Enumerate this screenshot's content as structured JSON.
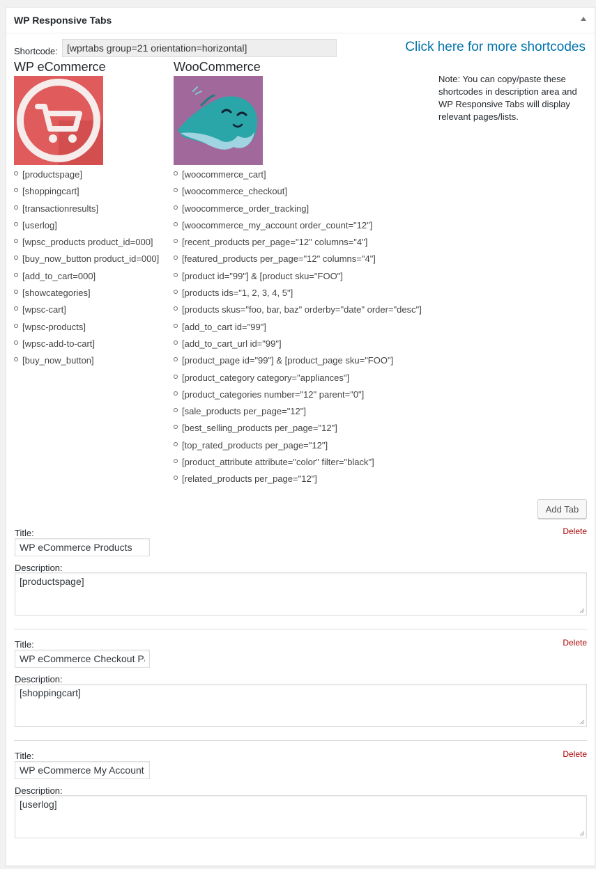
{
  "panel": {
    "title": "WP Responsive Tabs"
  },
  "shortcode": {
    "label": "Shortcode:",
    "value": "[wprtabs group=21 orientation=horizontal]"
  },
  "more_link": "Click here for more shortcodes",
  "note": "Note: You can copy/paste these shortcodes in description area and WP Responsive Tabs will display relevant pages/lists.",
  "columns": [
    {
      "heading": "WP eCommerce",
      "logo_icon": "shopping-cart-icon",
      "logo_color": "#e05b5b",
      "items": [
        "[productspage]",
        "[shoppingcart]",
        "[transactionresults]",
        "[userlog]",
        "[wpsc_products product_id=000]",
        "[buy_now_button product_id=000]",
        "[add_to_cart=000]",
        "[showcategories]",
        "[wpsc-cart]",
        "[wpsc-products]",
        "[wpsc-add-to-cart]",
        "[buy_now_button]"
      ]
    },
    {
      "heading": "WooCommerce",
      "logo_icon": "ninja-mascot-icon",
      "logo_color": "#a0689b",
      "items": [
        "[woocommerce_cart]",
        "[woocommerce_checkout]",
        "[woocommerce_order_tracking]",
        "[woocommerce_my_account order_count=\"12\"]",
        "[recent_products per_page=\"12\" columns=\"4\"]",
        "[featured_products per_page=\"12\" columns=\"4\"]",
        "[product id=\"99\"] & [product sku=\"FOO\"]",
        "[products ids=\"1, 2, 3, 4, 5\"]",
        "[products skus=\"foo, bar, baz\" orderby=\"date\" order=\"desc\"]",
        "[add_to_cart id=\"99\"]",
        "[add_to_cart_url id=\"99\"]",
        "[product_page id=\"99\"] & [product_page sku=\"FOO\"]",
        "[product_category category=\"appliances\"]",
        "[product_categories number=\"12\" parent=\"0\"]",
        "[sale_products per_page=\"12\"]",
        "[best_selling_products per_page=\"12\"]",
        "[top_rated_products per_page=\"12\"]",
        "[product_attribute attribute=\"color\" filter=\"black\"]",
        "[related_products per_page=\"12\"]"
      ]
    }
  ],
  "add_tab_label": "Add Tab",
  "tabs": [
    {
      "title_label": "Title:",
      "title_value": "WP eCommerce Products",
      "description_label": "Description:",
      "description_value": "[productspage]",
      "delete_label": "Delete"
    },
    {
      "title_label": "Title:",
      "title_value": "WP eCommerce Checkout Page",
      "description_label": "Description:",
      "description_value": "[shoppingcart]",
      "delete_label": "Delete"
    },
    {
      "title_label": "Title:",
      "title_value": "WP eCommerce My Account",
      "description_label": "Description:",
      "description_value": "[userlog]",
      "delete_label": "Delete"
    }
  ],
  "colors": {
    "link": "#0073aa",
    "delete": "#aa0000"
  }
}
